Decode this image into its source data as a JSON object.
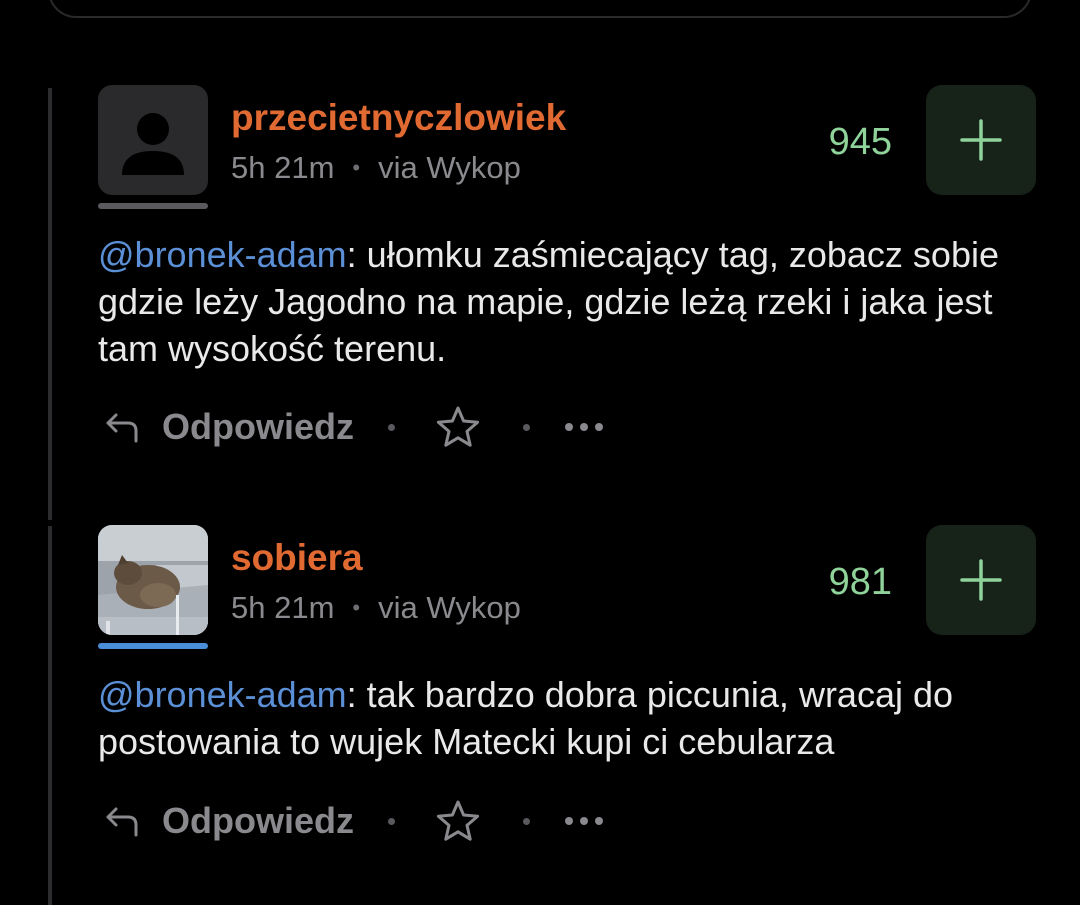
{
  "comments": [
    {
      "username": "przecietnyczlowiek",
      "time": "5h 21m",
      "via": "via Wykop",
      "score": "945",
      "mention": "@bronek-adam",
      "text": ": ułomku zaśmiecający tag, zobacz sobie gdzie leży Jagodno na mapie, gdzie leżą rzeki i jaka jest tam wysokość terenu.",
      "reply_label": "Odpowiedz",
      "avatar": "default-avatar-icon"
    },
    {
      "username": "sobiera",
      "time": "5h 21m",
      "via": "via Wykop",
      "score": "981",
      "mention": "@bronek-adam",
      "text": ": tak bardzo dobra piccunia, wracaj do postowania to wujek Matecki kupi ci cebularza",
      "reply_label": "Odpowiedz",
      "avatar": "cat-photo"
    }
  ],
  "colors": {
    "username": "#e06a32",
    "mention": "#5b8fd6",
    "score": "#8fd39a",
    "plus_bg": "#172319"
  }
}
